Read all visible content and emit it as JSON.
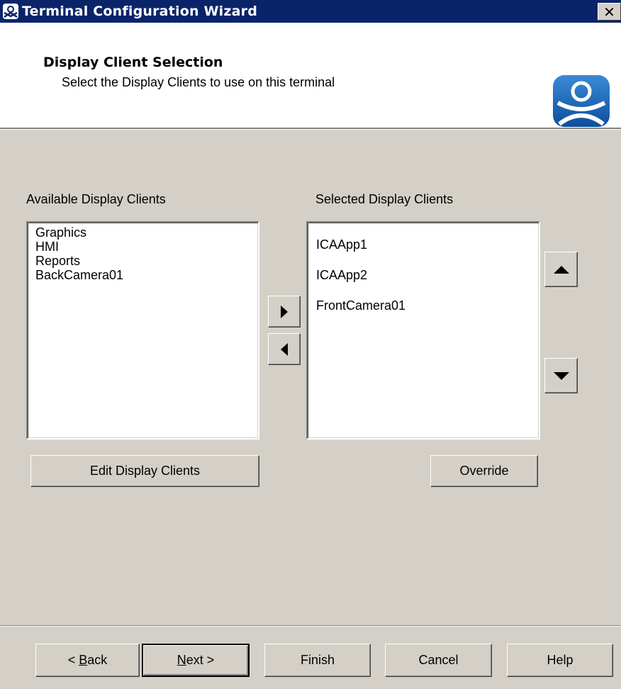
{
  "window": {
    "title": "Terminal Configuration Wizard",
    "close_label": "✕",
    "app_icon": "thinmanager-icon"
  },
  "header": {
    "title": "Display Client Selection",
    "subtitle": "Select the Display Clients to use on this terminal",
    "logo": "thinmanager-logo"
  },
  "available": {
    "label": "Available Display Clients",
    "items": [
      "Graphics",
      "HMI",
      "Reports",
      "BackCamera01"
    ],
    "edit_button": "Edit Display Clients"
  },
  "selected": {
    "label": "Selected Display Clients",
    "items": [
      "ICAApp1",
      "ICAApp2",
      "FrontCamera01"
    ],
    "override_button": "Override"
  },
  "transfer": {
    "add_icon": "arrow-right-icon",
    "remove_icon": "arrow-left-icon",
    "up_icon": "arrow-up-icon",
    "down_icon": "arrow-down-icon"
  },
  "footer": {
    "back_prefix": "< ",
    "back_key": "B",
    "back_rest": "ack",
    "next_key": "N",
    "next_rest": "ext >",
    "finish": "Finish",
    "cancel": "Cancel",
    "help": "Help"
  },
  "colors": {
    "titlebar": "#0a246a",
    "face": "#d4d0c8",
    "logo_blue": "#1c64b4"
  }
}
